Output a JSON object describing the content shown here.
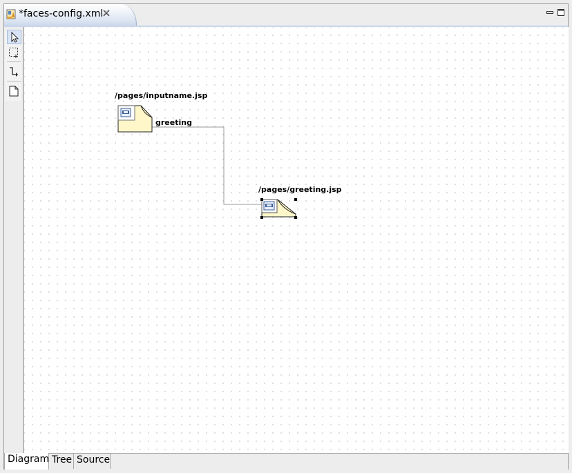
{
  "editor": {
    "tab_title": "*faces-config.xml",
    "tab_icon": "faces-config-file-icon",
    "close_icon": "close-icon"
  },
  "window_controls": {
    "minimize_icon": "minimize-icon",
    "maximize_icon": "maximize-icon"
  },
  "palette": {
    "tools": [
      {
        "icon": "select-arrow-icon",
        "selected": true
      },
      {
        "icon": "marquee-icon",
        "selected": false
      },
      {
        "icon": "connection-icon",
        "selected": false
      },
      {
        "icon": "page-icon",
        "selected": false
      }
    ]
  },
  "diagram": {
    "pages": [
      {
        "label": "/pages/inputname.jsp",
        "selected": false
      },
      {
        "label": "/pages/greeting.jsp",
        "selected": true
      }
    ],
    "navigation_case": {
      "label": "greeting",
      "from": "/pages/inputname.jsp",
      "to": "/pages/greeting.jsp"
    }
  },
  "bottom_tabs": [
    {
      "label": "Diagram",
      "active": true
    },
    {
      "label": "Tree",
      "active": false
    },
    {
      "label": "Source",
      "active": false
    }
  ],
  "colors": {
    "page_fill": "#fff6c9",
    "accent": "#c9d6ea"
  }
}
